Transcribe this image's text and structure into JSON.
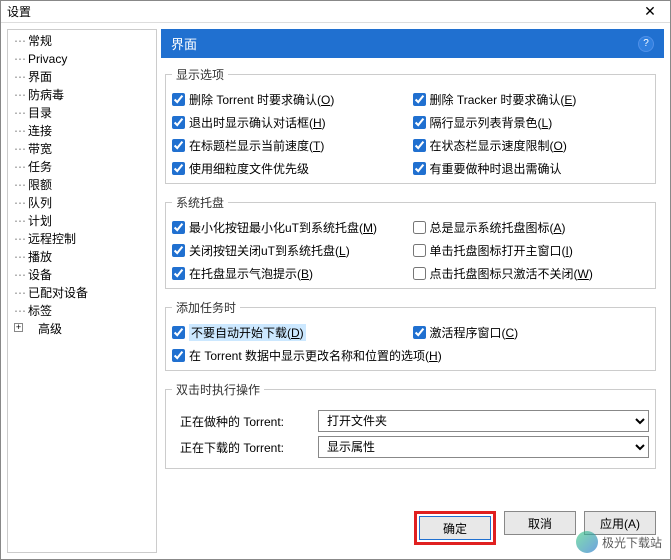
{
  "window": {
    "title": "设置"
  },
  "sidebar": {
    "items": [
      {
        "label": "常规"
      },
      {
        "label": "Privacy"
      },
      {
        "label": "界面"
      },
      {
        "label": "防病毒"
      },
      {
        "label": "目录"
      },
      {
        "label": "连接"
      },
      {
        "label": "带宽"
      },
      {
        "label": "任务"
      },
      {
        "label": "限额"
      },
      {
        "label": "队列"
      },
      {
        "label": "计划"
      },
      {
        "label": "远程控制"
      },
      {
        "label": "播放"
      },
      {
        "label": "设备"
      },
      {
        "label": "已配对设备"
      },
      {
        "label": "标签"
      },
      {
        "label": "高级"
      }
    ]
  },
  "header": {
    "title": "界面"
  },
  "groups": {
    "display": {
      "legend": "显示选项",
      "items": [
        {
          "checked": true,
          "label": "删除 Torrent 时要求确认(O)"
        },
        {
          "checked": true,
          "label": "删除 Tracker 时要求确认(E)"
        },
        {
          "checked": true,
          "label": "退出时显示确认对话框(H)"
        },
        {
          "checked": true,
          "label": "隔行显示列表背景色(L)"
        },
        {
          "checked": true,
          "label": "在标题栏显示当前速度(T)"
        },
        {
          "checked": true,
          "label": "在状态栏显示速度限制(O)"
        },
        {
          "checked": true,
          "label": "使用细粒度文件优先级"
        },
        {
          "checked": true,
          "label": "有重要做种时退出需确认"
        }
      ]
    },
    "tray": {
      "legend": "系统托盘",
      "items": [
        {
          "checked": true,
          "label": "最小化按钮最小化uT到系统托盘(M)"
        },
        {
          "checked": false,
          "label": "总是显示系统托盘图标(A)"
        },
        {
          "checked": true,
          "label": "关闭按钮关闭uT到系统托盘(L)"
        },
        {
          "checked": false,
          "label": "单击托盘图标打开主窗口(I)"
        },
        {
          "checked": true,
          "label": "在托盘显示气泡提示(B)"
        },
        {
          "checked": false,
          "label": "点击托盘图标只激活不关闭(W)"
        }
      ]
    },
    "addtask": {
      "legend": "添加任务时",
      "items": [
        {
          "checked": true,
          "label": "不要自动开始下载(D)",
          "highlight": true
        },
        {
          "checked": true,
          "label": "激活程序窗口(C)"
        },
        {
          "checked": true,
          "label": "在 Torrent 数据中显示更改名称和位置的选项(H)",
          "span2": true
        }
      ]
    },
    "dblclick": {
      "legend": "双击时执行操作",
      "rows": [
        {
          "label": "正在做种的 Torrent:",
          "value": "打开文件夹"
        },
        {
          "label": "正在下载的 Torrent:",
          "value": "显示属性"
        }
      ]
    }
  },
  "buttons": {
    "ok": "确定",
    "cancel": "取消",
    "apply": "应用(A)"
  },
  "watermark": "极光下载站"
}
